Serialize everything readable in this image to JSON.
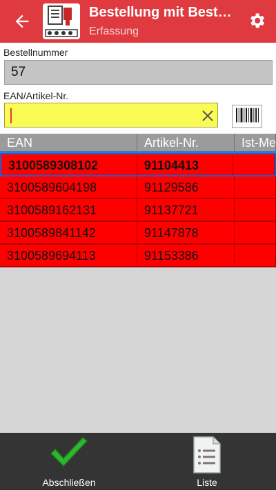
{
  "appbar": {
    "title": "Bestellung mit Bestandsprüfung",
    "subtitle": "Erfassung",
    "icons": {
      "back": "arrow-left-icon",
      "settings": "gear-icon",
      "logo": "app-logo-icon"
    }
  },
  "form": {
    "order_label": "Bestellnummer",
    "order_value": "57",
    "ean_label": "EAN/Artikel-Nr.",
    "ean_value": "",
    "icons": {
      "clear": "close-icon",
      "scan": "barcode-icon"
    }
  },
  "table": {
    "headers": [
      "EAN",
      "Artikel-Nr.",
      "Ist-Menge"
    ],
    "rows": [
      {
        "ean": "3100589308102",
        "art": "91104413",
        "qty": ""
      },
      {
        "ean": "3100589604198",
        "art": "91129586",
        "qty": ""
      },
      {
        "ean": "3100589162131",
        "art": "91137721",
        "qty": ""
      },
      {
        "ean": "3100589841142",
        "art": "91147878",
        "qty": ""
      },
      {
        "ean": "3100589694113",
        "art": "91153386",
        "qty": ""
      }
    ],
    "row_color": "#ff0000",
    "header_color": "#9b9b9b"
  },
  "bottom": {
    "finish_label": "Abschließen",
    "list_label": "Liste",
    "icons": {
      "finish": "checkmark-icon",
      "list": "list-document-icon"
    }
  },
  "colors": {
    "accent": "#de3a3f",
    "input_highlight": "#fbfb55"
  }
}
